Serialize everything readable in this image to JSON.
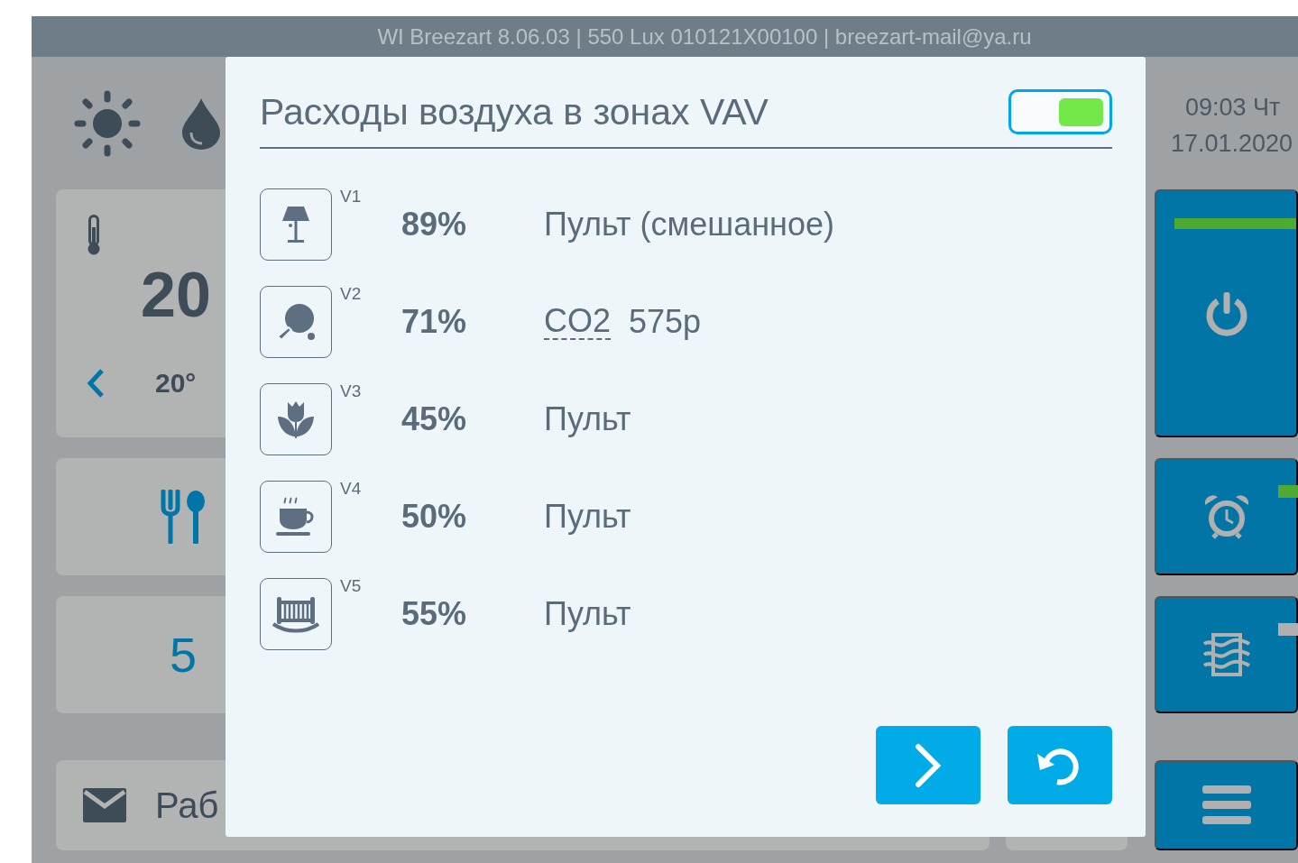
{
  "header": {
    "text": "WI Breezart 8.06.03 | 550 Lux 010121X00100 | breezart-mail@ya.ru"
  },
  "left_panel": {
    "temperature": "20",
    "setpoint": "20°",
    "mode_value": "5",
    "message": "Раб"
  },
  "clock": {
    "time": "09:03 Чт",
    "date": "17.01.2020"
  },
  "side_tiles": [
    {
      "kind": "power",
      "on": true
    },
    {
      "kind": "alarm",
      "on": true
    },
    {
      "kind": "airflow",
      "on": false
    },
    {
      "kind": "menu"
    }
  ],
  "dialog": {
    "title": "Расходы воздуха в зонах VAV",
    "enabled": true,
    "zones": [
      {
        "kind": "lamp",
        "label": "V1",
        "percent": "89%",
        "mode": "Пульт (смешанное)"
      },
      {
        "kind": "paddle",
        "label": "V2",
        "percent": "71%",
        "sensor": "CO2",
        "reading": "575p"
      },
      {
        "kind": "tulip",
        "label": "V3",
        "percent": "45%",
        "mode": "Пульт"
      },
      {
        "kind": "cup",
        "label": "V4",
        "percent": "50%",
        "mode": "Пульт"
      },
      {
        "kind": "crib",
        "label": "V5",
        "percent": "55%",
        "mode": "Пульт"
      }
    ],
    "buttons": [
      {
        "kind": "next"
      },
      {
        "kind": "reset"
      }
    ]
  }
}
